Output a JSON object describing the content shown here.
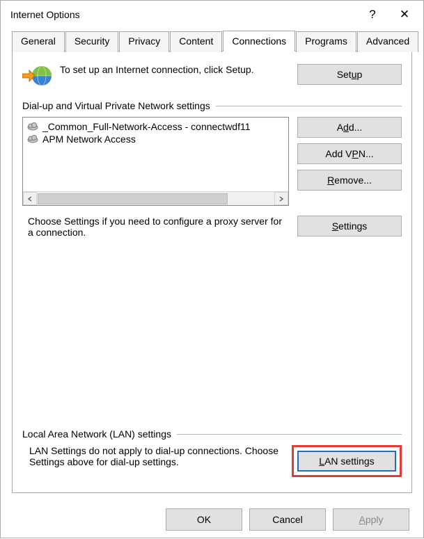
{
  "window": {
    "title": "Internet Options",
    "help_symbol": "?",
    "close_symbol": "✕"
  },
  "tabs": [
    "General",
    "Security",
    "Privacy",
    "Content",
    "Connections",
    "Programs",
    "Advanced"
  ],
  "active_tab_index": 4,
  "setup": {
    "text": "To set up an Internet connection, click Setup.",
    "button": "Setup"
  },
  "dialup": {
    "header": "Dial-up and Virtual Private Network settings",
    "items": [
      "_Common_Full-Network-Access - connectwdf11",
      "APM Network Access"
    ],
    "buttons": {
      "add": "Add...",
      "add_vpn": "Add VPN...",
      "remove": "Remove...",
      "settings": "Settings"
    },
    "hint": "Choose Settings if you need to configure a proxy server for a connection."
  },
  "lan": {
    "header": "Local Area Network (LAN) settings",
    "text": "LAN Settings do not apply to dial-up connections. Choose Settings above for dial-up settings.",
    "button": "LAN settings"
  },
  "footer": {
    "ok": "OK",
    "cancel": "Cancel",
    "apply": "Apply"
  }
}
